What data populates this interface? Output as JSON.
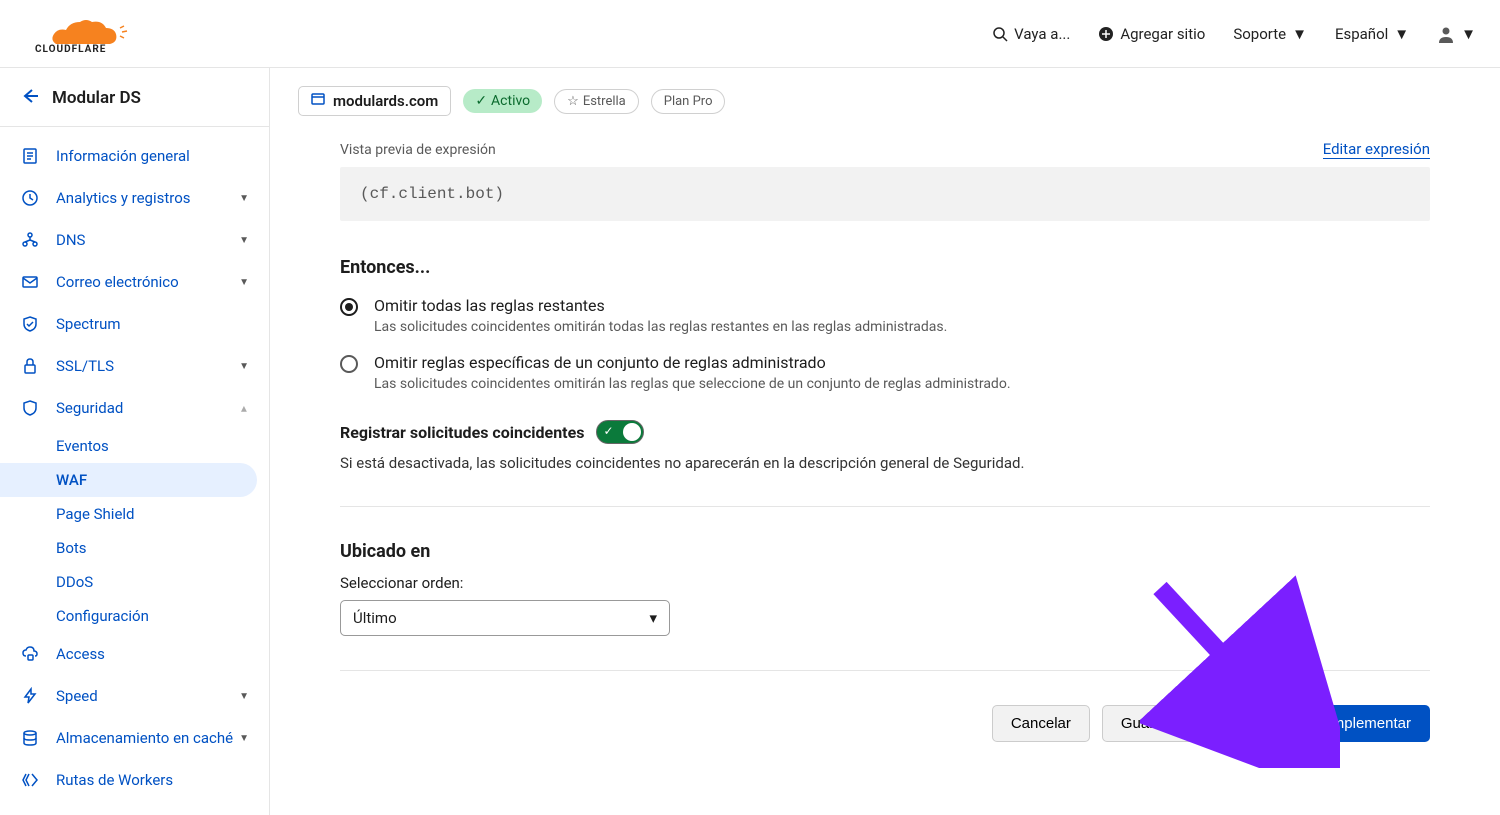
{
  "topbar": {
    "search_placeholder": "Vaya a...",
    "add_site": "Agregar sitio",
    "support": "Soporte",
    "language": "Español"
  },
  "sidebar": {
    "title": "Modular DS",
    "items": [
      {
        "label": "Información general",
        "expandable": false
      },
      {
        "label": "Analytics y registros",
        "expandable": true
      },
      {
        "label": "DNS",
        "expandable": true
      },
      {
        "label": "Correo electrónico",
        "expandable": true
      },
      {
        "label": "Spectrum",
        "expandable": false
      },
      {
        "label": "SSL/TLS",
        "expandable": true
      },
      {
        "label": "Seguridad",
        "expandable": true,
        "expanded": true
      },
      {
        "label": "Access",
        "expandable": false
      },
      {
        "label": "Speed",
        "expandable": true
      },
      {
        "label": "Almacenamiento en caché",
        "expandable": true
      },
      {
        "label": "Rutas de Workers",
        "expandable": false
      }
    ],
    "security_sub": [
      {
        "label": "Eventos"
      },
      {
        "label": "WAF",
        "active": true
      },
      {
        "label": "Page Shield"
      },
      {
        "label": "Bots"
      },
      {
        "label": "DDoS"
      },
      {
        "label": "Configuración"
      }
    ]
  },
  "domain_bar": {
    "domain": "modulards.com",
    "status": "Activo",
    "star": "Estrella",
    "plan": "Plan Pro"
  },
  "expression": {
    "preview_label": "Vista previa de expresión",
    "edit_link": "Editar expresión",
    "code": "(cf.client.bot)"
  },
  "then_section": {
    "title": "Entonces...",
    "options": [
      {
        "label": "Omitir todas las reglas restantes",
        "desc": "Las solicitudes coincidentes omitirán todas las reglas restantes en las reglas administradas.",
        "selected": true
      },
      {
        "label": "Omitir reglas específicas de un conjunto de reglas administrado",
        "desc": "Las solicitudes coincidentes omitirán las reglas que seleccione de un conjunto de reglas administrado.",
        "selected": false
      }
    ]
  },
  "log_toggle": {
    "label": "Registrar solicitudes coincidentes",
    "desc": "Si está desactivada, las solicitudes coincidentes no aparecerán en la descripción general de Seguridad."
  },
  "placement": {
    "title": "Ubicado en",
    "select_label": "Seleccionar orden:",
    "value": "Último"
  },
  "buttons": {
    "cancel": "Cancelar",
    "draft": "Guardar como borrador",
    "deploy": "Implementar"
  }
}
